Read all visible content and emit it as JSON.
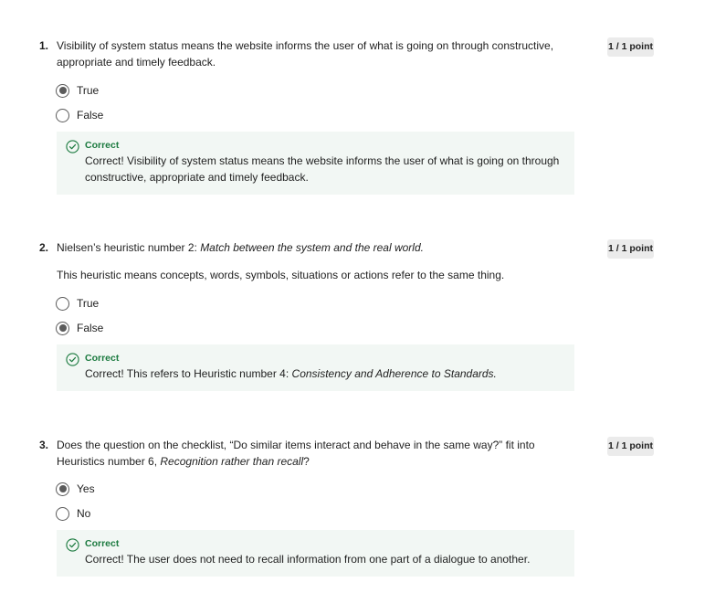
{
  "questions": [
    {
      "number": "1.",
      "text": "Visibility of system status means the website informs the user of what is going on through constructive, appropriate and timely feedback.",
      "points": "1 / 1 point",
      "options": [
        {
          "label": "True",
          "selected": true
        },
        {
          "label": "False",
          "selected": false
        }
      ],
      "feedback": {
        "title": "Correct",
        "text": "Correct! Visibility of system status means the website informs the user of what is going on through constructive, appropriate and timely feedback."
      }
    },
    {
      "number": "2.",
      "text_prefix": "Nielsen’s heuristic number 2: ",
      "text_italic": "Match between the system and the real world.",
      "subtext": "This heuristic means concepts, words, symbols, situations or actions refer to the same thing.",
      "points": "1 / 1 point",
      "options": [
        {
          "label": "True",
          "selected": false
        },
        {
          "label": "False",
          "selected": true
        }
      ],
      "feedback": {
        "title": "Correct",
        "text_prefix": "Correct! This refers to Heuristic number 4: ",
        "text_italic": "Consistency and Adherence to Standards."
      }
    },
    {
      "number": "3.",
      "text_prefix": "Does the question on the checklist, “Do similar items interact and behave in the same way?” fit into Heuristics number 6, ",
      "text_italic": "Recognition rather than recall",
      "text_suffix": "?",
      "points": "1 / 1 point",
      "options": [
        {
          "label": "Yes",
          "selected": true
        },
        {
          "label": "No",
          "selected": false
        }
      ],
      "feedback": {
        "title": "Correct",
        "text": "Correct! The user does not need to recall information from one part of a dialogue to another."
      }
    }
  ],
  "colors": {
    "correct": "#1b7a3f",
    "feedback_bg": "#f2f7f4",
    "points_bg": "#ebebeb",
    "radio": "#5b5b5b"
  },
  "icons": {
    "correct": "check-circle-icon"
  }
}
